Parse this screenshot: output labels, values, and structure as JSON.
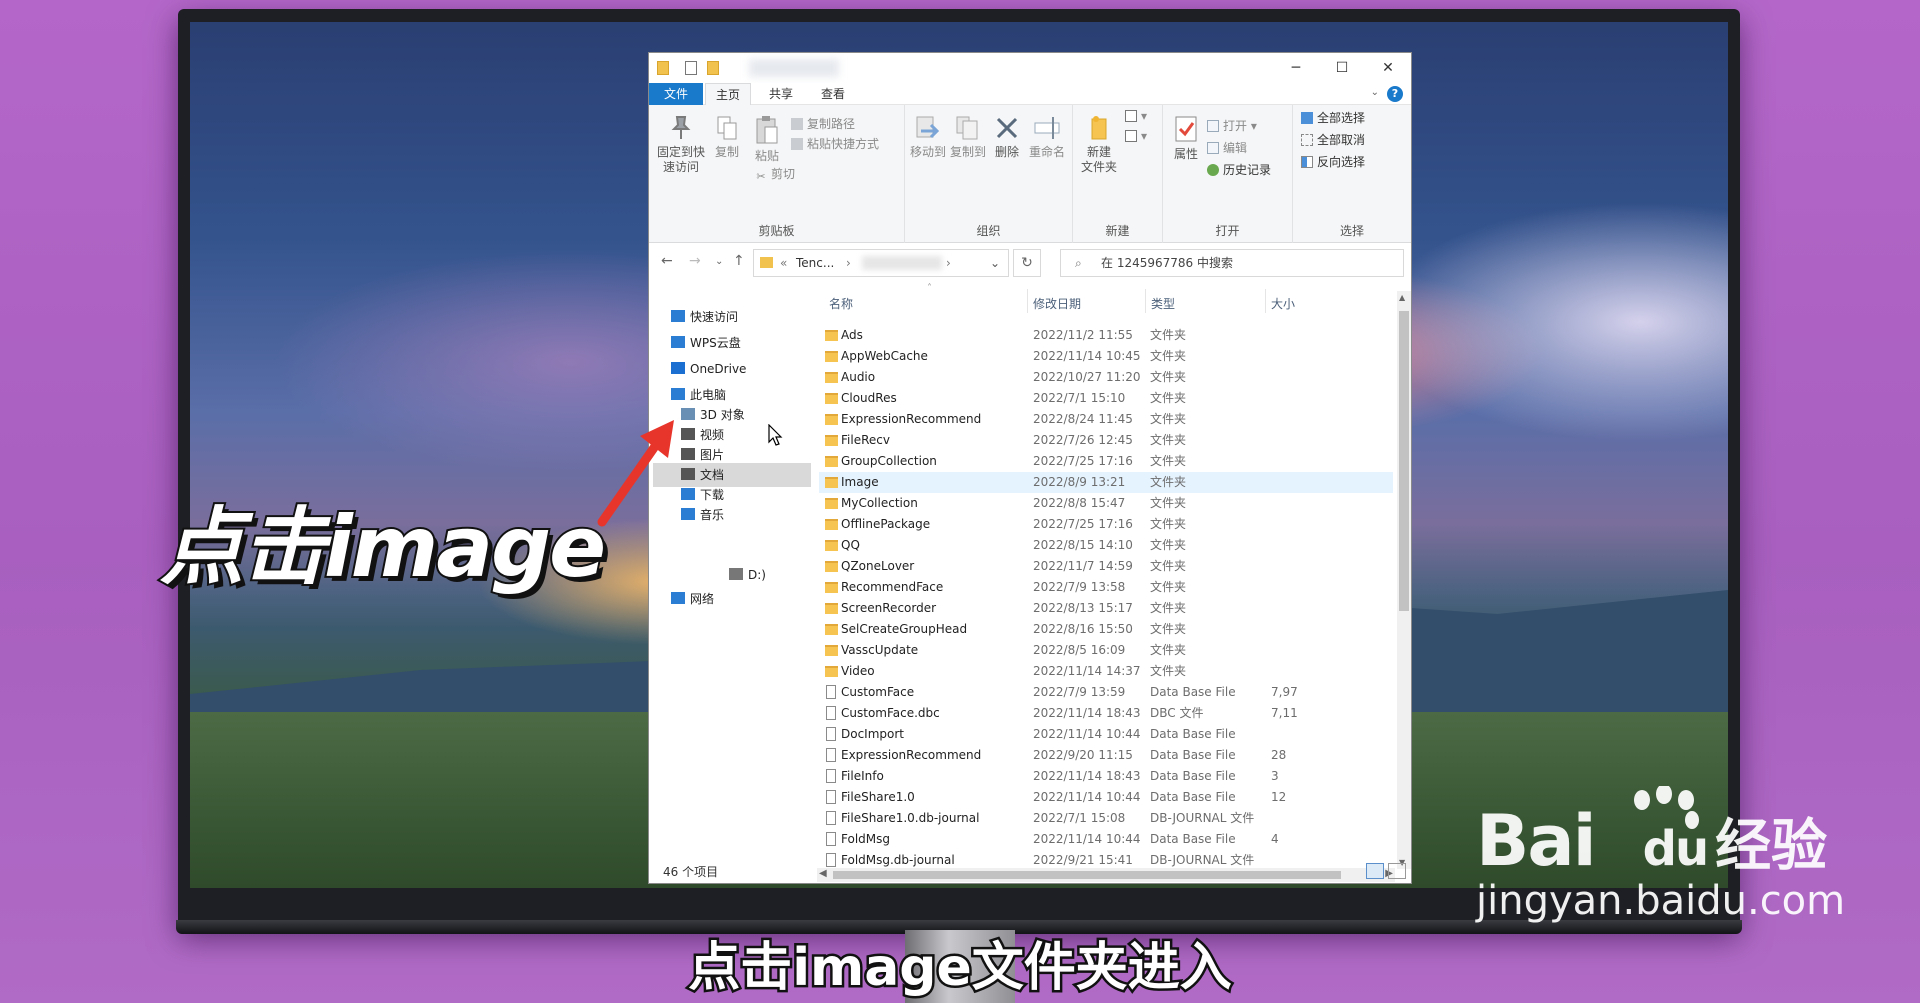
{
  "window": {
    "controls": {
      "minimize": "─",
      "maximize": "☐",
      "close": "✕"
    }
  },
  "ribbon_tabs": [
    "文件",
    "主页",
    "共享",
    "查看"
  ],
  "ribbon": {
    "clipboard": {
      "pin": "固定到快\n速访问",
      "copy": "复制",
      "paste": "粘贴",
      "copy_path": "复制路径",
      "paste_shortcut": "粘贴快捷方式",
      "cut": "剪切",
      "label": "剪贴板"
    },
    "organize": {
      "move_to": "移动到",
      "copy_to": "复制到",
      "delete": "删除",
      "rename": "重命名",
      "label": "组织"
    },
    "new": {
      "new_folder": "新建\n文件夹",
      "label": "新建"
    },
    "open": {
      "properties": "属性",
      "open": "打开",
      "edit": "编辑",
      "history": "历史记录",
      "label": "打开"
    },
    "select": {
      "select_all": "全部选择",
      "select_none": "全部取消",
      "invert": "反向选择",
      "label": "选择"
    }
  },
  "address": {
    "prefix": "«",
    "crumb": "Tenc...",
    "search_placeholder": "在 1245967786 中搜索"
  },
  "nav_pane": [
    {
      "label": "快速访问",
      "icon": "star-icon"
    },
    {
      "label": "WPS云盘",
      "icon": "cloud-icon"
    },
    {
      "label": "OneDrive",
      "icon": "onedrive-icon"
    },
    {
      "label": "此电脑",
      "icon": "computer-icon"
    },
    {
      "label": "3D 对象",
      "icon": "cube-icon"
    },
    {
      "label": "视频",
      "icon": "video-icon"
    },
    {
      "label": "图片",
      "icon": "picture-icon"
    },
    {
      "label": "文档",
      "icon": "document-icon"
    },
    {
      "label": "下载",
      "icon": "download-icon"
    },
    {
      "label": "音乐",
      "icon": "music-icon"
    },
    {
      "label": "D:)",
      "icon": "drive-icon"
    },
    {
      "label": "网络",
      "icon": "network-icon"
    }
  ],
  "columns": {
    "name": "名称",
    "date": "修改日期",
    "type": "类型",
    "size": "大小"
  },
  "files": [
    {
      "name": "Ads",
      "date": "2022/11/2 11:55",
      "type": "文件夹",
      "size": "",
      "kind": "folder"
    },
    {
      "name": "AppWebCache",
      "date": "2022/11/14 10:45",
      "type": "文件夹",
      "size": "",
      "kind": "folder"
    },
    {
      "name": "Audio",
      "date": "2022/10/27 11:20",
      "type": "文件夹",
      "size": "",
      "kind": "folder"
    },
    {
      "name": "CloudRes",
      "date": "2022/7/1 15:10",
      "type": "文件夹",
      "size": "",
      "kind": "folder"
    },
    {
      "name": "ExpressionRecommend",
      "date": "2022/8/24 11:45",
      "type": "文件夹",
      "size": "",
      "kind": "folder"
    },
    {
      "name": "FileRecv",
      "date": "2022/7/26 12:45",
      "type": "文件夹",
      "size": "",
      "kind": "folder"
    },
    {
      "name": "GroupCollection",
      "date": "2022/7/25 17:16",
      "type": "文件夹",
      "size": "",
      "kind": "folder"
    },
    {
      "name": "Image",
      "date": "2022/8/9 13:21",
      "type": "文件夹",
      "size": "",
      "kind": "folder",
      "selected": true
    },
    {
      "name": "MyCollection",
      "date": "2022/8/8 15:47",
      "type": "文件夹",
      "size": "",
      "kind": "folder"
    },
    {
      "name": "OfflinePackage",
      "date": "2022/7/25 17:16",
      "type": "文件夹",
      "size": "",
      "kind": "folder"
    },
    {
      "name": "QQ",
      "date": "2022/8/15 14:10",
      "type": "文件夹",
      "size": "",
      "kind": "folder"
    },
    {
      "name": "QZoneLover",
      "date": "2022/11/7 14:59",
      "type": "文件夹",
      "size": "",
      "kind": "folder"
    },
    {
      "name": "RecommendFace",
      "date": "2022/7/9 13:58",
      "type": "文件夹",
      "size": "",
      "kind": "folder"
    },
    {
      "name": "ScreenRecorder",
      "date": "2022/8/13 15:17",
      "type": "文件夹",
      "size": "",
      "kind": "folder"
    },
    {
      "name": "SelCreateGroupHead",
      "date": "2022/8/16 15:50",
      "type": "文件夹",
      "size": "",
      "kind": "folder"
    },
    {
      "name": "VasscUpdate",
      "date": "2022/8/5 16:09",
      "type": "文件夹",
      "size": "",
      "kind": "folder"
    },
    {
      "name": "Video",
      "date": "2022/11/14 14:37",
      "type": "文件夹",
      "size": "",
      "kind": "folder"
    },
    {
      "name": "CustomFace",
      "date": "2022/7/9 13:59",
      "type": "Data Base File",
      "size": "7,97",
      "kind": "file"
    },
    {
      "name": "CustomFace.dbc",
      "date": "2022/11/14 18:43",
      "type": "DBC 文件",
      "size": "7,11",
      "kind": "file"
    },
    {
      "name": "DocImport",
      "date": "2022/11/14 10:44",
      "type": "Data Base File",
      "size": "",
      "kind": "file"
    },
    {
      "name": "ExpressionRecommend",
      "date": "2022/9/20 11:15",
      "type": "Data Base File",
      "size": "28",
      "kind": "file"
    },
    {
      "name": "FileInfo",
      "date": "2022/11/14 18:43",
      "type": "Data Base File",
      "size": "3",
      "kind": "file"
    },
    {
      "name": "FileShare1.0",
      "date": "2022/11/14 10:44",
      "type": "Data Base File",
      "size": "12",
      "kind": "file"
    },
    {
      "name": "FileShare1.0.db-journal",
      "date": "2022/7/1 15:08",
      "type": "DB-JOURNAL 文件",
      "size": "",
      "kind": "file"
    },
    {
      "name": "FoldMsg",
      "date": "2022/11/14 10:44",
      "type": "Data Base File",
      "size": "4",
      "kind": "file"
    },
    {
      "name": "FoldMsg.db-journal",
      "date": "2022/9/21 15:41",
      "type": "DB-JOURNAL 文件",
      "size": "",
      "kind": "file"
    }
  ],
  "status": "46 个项目",
  "overlay": {
    "big_caption": "点击image",
    "subtitle": "点击image文件夹进入"
  },
  "watermark": {
    "brand": "Bai",
    "brand_suffix": "du",
    "product": "经验",
    "url": "jingyan.baidu.com"
  },
  "colors": {
    "accent": "#1979ca",
    "selection": "#e5f3ff",
    "folder": "#f5c451",
    "arrow": "#e8352b"
  }
}
